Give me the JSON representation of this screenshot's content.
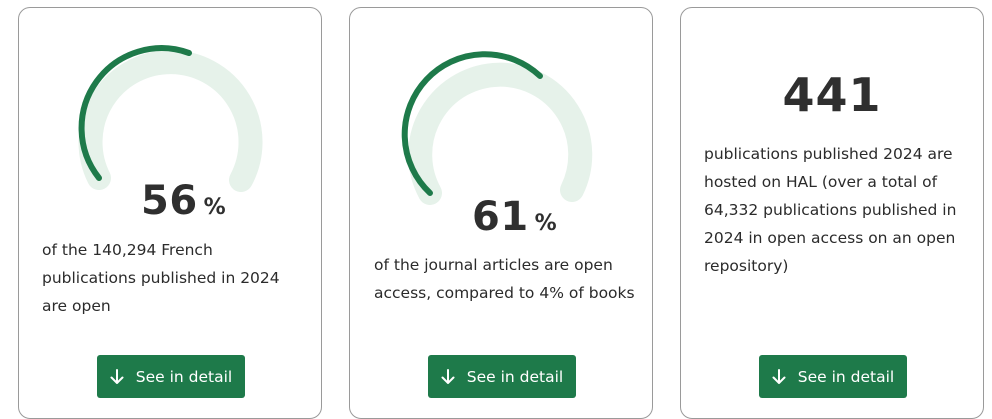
{
  "colors": {
    "accent": "#1e7a4a",
    "gauge_track": "#e6f2ea",
    "text": "#2b2b2b"
  },
  "cards": [
    {
      "value": "56",
      "unit": "%",
      "gauge_fraction": 0.56,
      "description": "of the 140,294 French publications published in 2024 are open",
      "button_label": "See in detail",
      "button_icon": "arrow-down-icon"
    },
    {
      "value": "61",
      "unit": "%",
      "gauge_fraction": 0.61,
      "description": "of the journal articles are open access, compared to 4% of books",
      "button_label": "See in detail",
      "button_icon": "arrow-down-icon"
    },
    {
      "value": "441",
      "description": "publications published 2024 are hosted on HAL (over a total of 64,332 publications published in 2024 in open access on an open repository)",
      "button_label": "See in detail",
      "button_icon": "arrow-down-icon"
    }
  ]
}
